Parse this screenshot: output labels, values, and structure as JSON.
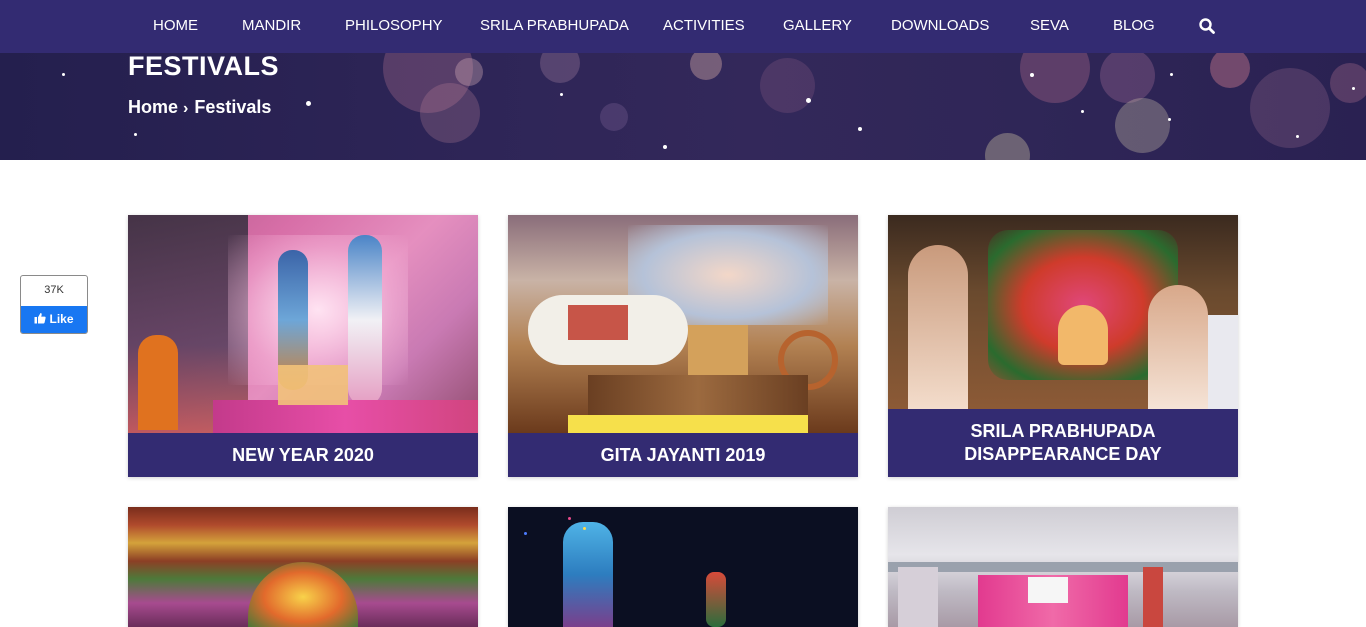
{
  "nav": {
    "items": [
      "HOME",
      "MANDIR",
      "PHILOSOPHY",
      "SRILA PRABHUPADA",
      "ACTIVITIES",
      "GALLERY",
      "DOWNLOADS",
      "SEVA",
      "BLOG"
    ],
    "search_icon": "search-icon"
  },
  "hero": {
    "title": "FESTIVALS",
    "breadcrumb": {
      "home": "Home",
      "current": "Festivals",
      "separator_icon": "chevron-right-icon"
    }
  },
  "fb_like": {
    "count": "37K",
    "label": "Like",
    "icon": "thumbs-up-icon"
  },
  "festivals": [
    {
      "title": "NEW YEAR 2020"
    },
    {
      "title": "GITA JAYANTI 2019"
    },
    {
      "title": "SRILA PRABHUPADA DISAPPEARANCE DAY"
    },
    {
      "title": ""
    },
    {
      "title": ""
    },
    {
      "title": ""
    }
  ],
  "colors": {
    "brand_purple": "#332b72",
    "facebook_blue": "#1877f2"
  }
}
